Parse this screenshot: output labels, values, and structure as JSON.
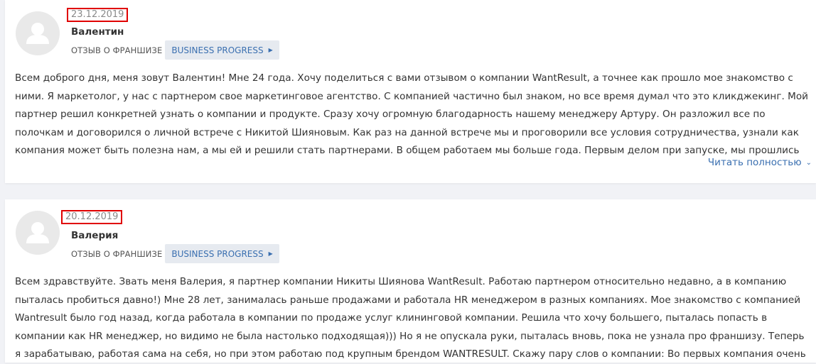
{
  "reviews": [
    {
      "date": "23.12.2019",
      "author": "Валентин",
      "category_label": "ОТЗЫВ О ФРАНШИЗЕ",
      "franchise_tag": "BUSINESS PROGRESS",
      "text": "Всем доброго дня, меня зовут Валентин! Мне 24 года. Хочу поделиться с вами отзывом о компании WantResult, а точнее как прошло мое знакомство с ними. Я маркетолог, у нас с партнером свое маркетинговое агентство. С компанией частично был знаком, но все время думал что это кликджекинг. Мой партнер решил конкретней узнать о компании и продукте. Сразу хочу огромную благодарность нашему менеджеру Артуру. Он разложил все по полочкам и договорился о личной встрече с Никитой Шияновым. Как раз на данной встрече мы и проговорили все условия сотрудничества, узнали как компания может быть полезна нам, а мы ей и решили стать партнерами. В общем работаем мы больше года. Первым делом при запуске, мы прошлись по нашим клиентам, и",
      "read_more": "Читать полностью"
    },
    {
      "date": "20.12.2019",
      "author": "Валерия",
      "category_label": "ОТЗЫВ О ФРАНШИЗЕ",
      "franchise_tag": "BUSINESS PROGRESS",
      "text": "Всем здравствуйте. Звать меня Валерия, я партнер компании Никиты Шиянова WantResult. Работаю партнером относительно недавно, а в компанию пыталась пробиться давно!) Мне 28 лет, занималась раньше продажами и работала HR менеджером в разных компаниях. Мое знакомство с компанией Wantresult было год назад, когда работала в компании по продаже услуг клининговой компании. Решила что хочу большего, пыталась попасть в компании как HR менеджер, но видимо не была настолько подходящая))) Но я не опускала руки, пыталась вновь, пока не узнала про франшизу. Теперь я зарабатываю, работая сама на себя, но при этом работаю под крупным брендом WANTRESULT. Скажу пару слов о компании: Во первых компания очень перспективная, во"
    }
  ]
}
